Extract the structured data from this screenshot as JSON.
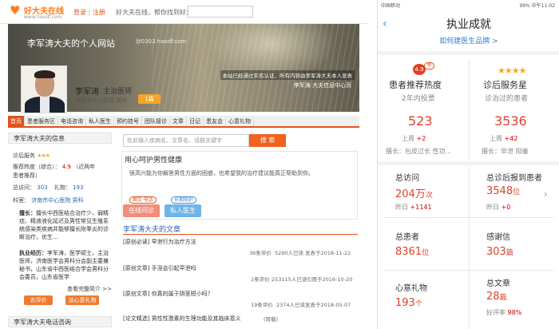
{
  "left": {
    "logo": {
      "name": "好大夫在线",
      "url": "www.haodf.com"
    },
    "auth": {
      "login": "登录",
      "sep": "|",
      "register": "注册"
    },
    "tagline": "好大夫在线，帮你找到好大夫",
    "banner": {
      "site_title": "李军涛大夫的个人网站",
      "site_url": "ljt0303.haodf.com",
      "verify_text": "本站已经通过实名认证，所有内容由李军涛大夫本人发表",
      "info_center": "李军涛 大夫信息中心页"
    },
    "doctor": {
      "name": "李军涛",
      "title": "主治医师",
      "hospital": "济南市中心医院  男科",
      "badge": "1篇"
    },
    "tabs": [
      "首页",
      "患者服务区",
      "电话咨询",
      "私人医生",
      "预约挂号",
      "团队接诊",
      "文章",
      "日记",
      "患友会",
      "心意礼物"
    ],
    "sidebar": {
      "header": "李军涛大夫的信息",
      "rating_label": "诊后服务",
      "rating_stars": "★★★",
      "heat_label": "推荐热度（综合）：",
      "heat_value": "4.9",
      "heat_note": "（近两年",
      "heat_note2": "患者推荐）",
      "visits_label": "总访问：",
      "visits_value": "303",
      "gifts_label": "礼物：",
      "gifts_value": "193",
      "dept_label": "科室：",
      "dept_value": "济南市中心医院 男科",
      "skill_label": "擅长：",
      "skill_text": "擅长中西医结合治疗少、弱精症、精液液化延迟及男性常见生殖系统感染类疾病并能够擅长附睾炎的诊断治疗，优生...",
      "resume_label": "执业经历：",
      "resume_text": "李军涛，医学硕士，主治医师，济南医学会男科分会副主委兼秘书，山东省中西医结合学会男科分会委员，山东省医学",
      "more_link": "查看完整简介 >>",
      "btn_review": "去评价",
      "btn_gift": "送心意礼物",
      "footer": "李军涛大夫电话咨询"
    },
    "search": {
      "placeholder": "在此输入疾病名、文章名、话题关键字",
      "button": "搜 索"
    },
    "box": {
      "title": "用心呵护男性健康",
      "desc": "很高兴能为你解答男性方面的困惑，也希望我的治疗建议能真正帮助到你。",
      "btn1": "在线问诊",
      "btn1_badge": "图文·电话",
      "btn2": "私人医生",
      "btn2_badge": "长期陪护"
    },
    "articles": {
      "header": "李军涛大夫的文章",
      "items": [
        {
          "title": "[原创必读] 早泄行为治疗方法",
          "meta1": "36条评价",
          "meta2": "5290人已读",
          "meta3": "发表于2018-11-22"
        },
        {
          "title": "[原创文章] 手淫会引起早泄吗",
          "meta1": "1条评价",
          "meta2": "253115人已读",
          "meta3": "引用于2016-10-20"
        },
        {
          "title": "[原创文章] 你真的属于阴茎短小吗？",
          "meta1": "19条评价",
          "meta2": "2374人已读",
          "meta3": "发表于2018-05-07"
        },
        {
          "title": "[论文精选] 男性性激素的生理功能及其临床意义",
          "meta1": "(转载)",
          "meta2": "",
          "meta3": ""
        }
      ]
    }
  },
  "right": {
    "status": {
      "left": "中国移动",
      "right": "99% 中午11:02"
    },
    "title": "执业成就",
    "link": "如何建医生品牌 >",
    "recommend": {
      "title": "患者推荐热度",
      "sub": "2年内投票",
      "score": "4.9",
      "badge": "荐",
      "value": "523",
      "delta_label": "上周",
      "delta": "+2",
      "tags": "擅长：包皮过长 性功..."
    },
    "service": {
      "title": "诊后服务星",
      "sub": "诊治过的患者",
      "stars": "★★★★",
      "value": "3536",
      "delta_label": "上周",
      "delta": "+42",
      "tags": "擅长：早泄 阳痿"
    },
    "visits": {
      "title": "总访问",
      "value": "204万",
      "unit": "次",
      "delta_label": "昨日",
      "delta": "+1141"
    },
    "reports": {
      "title": "总诊后报到患者",
      "value": "3548",
      "unit": "位",
      "delta_label": "昨日",
      "delta": "+0"
    },
    "patients": {
      "title": "总患者",
      "value": "8361",
      "unit": "位"
    },
    "thanks": {
      "title": "感谢信",
      "value": "303",
      "unit": "篇"
    },
    "gifts": {
      "title": "心意礼物",
      "value": "193",
      "unit": "个"
    },
    "papers": {
      "title": "总文章",
      "value": "28",
      "unit": "篇",
      "good_label": "好评率",
      "good": "98%"
    }
  }
}
